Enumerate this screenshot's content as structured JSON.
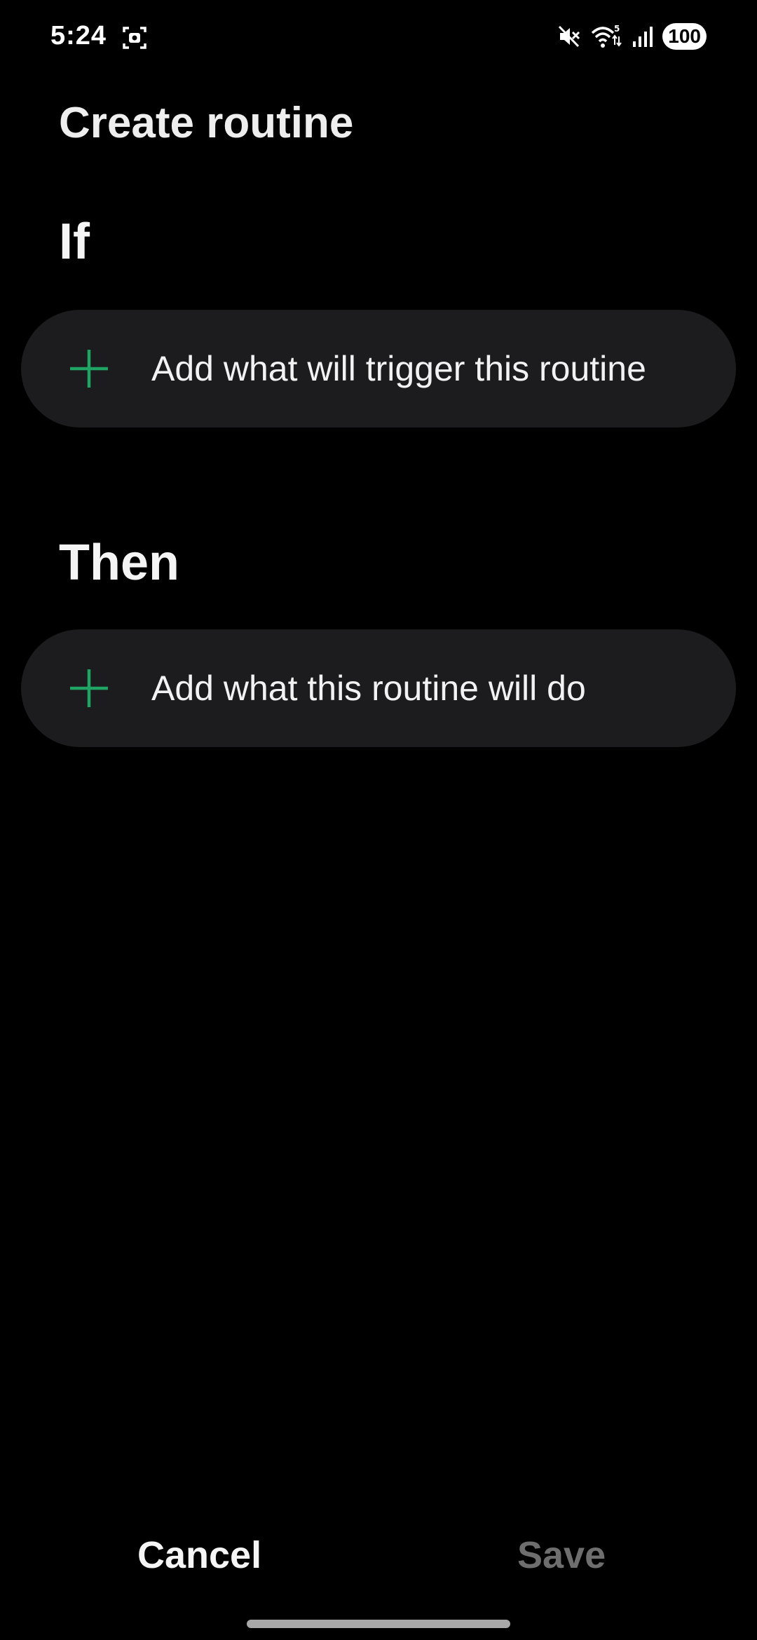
{
  "status_bar": {
    "time": "5:24",
    "battery": "100",
    "icons": [
      "screenshot-icon",
      "mute-icon",
      "wifi-icon",
      "signal-icon"
    ]
  },
  "page": {
    "title": "Create routine"
  },
  "if_section": {
    "heading": "If",
    "add_label": "Add what will trigger this routine"
  },
  "then_section": {
    "heading": "Then",
    "add_label": "Add what this routine will do"
  },
  "bottom_bar": {
    "cancel_label": "Cancel",
    "save_label": "Save"
  },
  "colors": {
    "background": "#000000",
    "card": "#1c1c1e",
    "accent_plus": "#1fa463",
    "disabled_text": "#6e6e6e"
  }
}
